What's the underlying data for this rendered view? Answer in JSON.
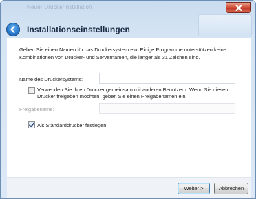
{
  "window": {
    "title": "Neuer Druckerinstallation"
  },
  "header": {
    "title": "Installationseinstellungen"
  },
  "intro": {
    "text": "Geben Sie einen Namen für das Druckersystem ein. Einige Programme unterstützen keine Kombinationen von Drucker- und Servernamen, die länger als 31 Zeichen sind."
  },
  "form": {
    "name_label": "Name des Druckersystems:",
    "name_value": "",
    "share_checkbox_label": "Verwenden Sie Ihren Drucker gemeinsam mit anderen Benutzern. Wenn Sie diesen Drucker freigeben möchten, geben Sie einen Freigabenamen ein.",
    "share_checked": false,
    "share_name_label": "Freigabename:",
    "share_name_value": "",
    "default_checkbox_label": "Als Standarddrucker festlegen",
    "default_checked": true
  },
  "buttons": {
    "next_label": "Weiter >",
    "cancel_label": "Abbrechen"
  },
  "icons": {
    "close": "close-icon",
    "back": "back-arrow-icon",
    "check": "checkmark-icon"
  },
  "colors": {
    "accent": "#2a7ccd",
    "close": "#c0392a"
  }
}
